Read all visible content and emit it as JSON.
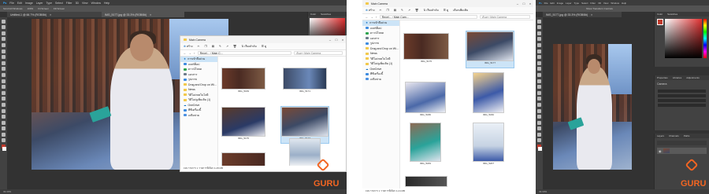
{
  "left_ps": {
    "menu": [
      "Ps",
      "File",
      "Edit",
      "Image",
      "Layer",
      "Type",
      "Select",
      "Filter",
      "3D",
      "View",
      "Window",
      "Help"
    ],
    "options": [
      "Scroll All Windows",
      "100%",
      "Fit Screen",
      "Fill Screen"
    ],
    "doc_tab": "Untitled-1 @ 66.7% (RGB/8#)",
    "doc_tab2": "IMG_5177.jpg @ 33.3% (RGB/8#)",
    "panel_tabs": [
      "Color",
      "Swatches"
    ],
    "status": "33.33%"
  },
  "left_explorer": {
    "title": "Main Camera",
    "new_label": "สร้าง",
    "sort_label": "เรียงลำดับ",
    "view_label": "ดู",
    "path": [
      "Recei...",
      "Main C..."
    ],
    "search_placeholder": "ค้นหา Main Camera",
    "nav": [
      "การเข้าถึงด่วน",
      "เดสก์ท็อป",
      "ดาวน์โหลด",
      "เอกสาร",
      "รูปภาพ",
      "Drag and Drop on Wi...",
      "News",
      "วิดีโอ/เทคโนโลยี",
      "วิดีโอ/ดูเพิ่มเติม (1)",
      "OneDrive",
      "พีซีเครื่องนี้",
      "เครือข่าย"
    ],
    "thumbs": [
      "IMG_5169",
      "IMG_5171",
      "IMG_5175",
      "IMG_5177",
      "",
      ""
    ],
    "status": "199 รายการ     1 รายการที่เลือก 4.28 MB"
  },
  "right_explorer": {
    "title": "Main Camera",
    "new_label": "สร้าง",
    "sort_label": "เรียงลำดับ",
    "view_label": "ดู",
    "more_label": "เลือกเพิ่มเติม",
    "path": [
      "Recei...",
      "Main Cam..."
    ],
    "search_placeholder": "ค้นหา Main Camera",
    "nav": [
      "การเข้าถึงด่วน",
      "เดสก์ท็อป",
      "ดาวน์โหลด",
      "เอกสาร",
      "รูปภาพ",
      "Drag and Drop on Wi...",
      "News",
      "วิดีโอ/เทคโนโลยี",
      "วิดีโอ/ดูเพิ่มเติม (1)",
      "OneDrive",
      "พีซีเครื่องนี้",
      "เครือข่าย"
    ],
    "thumbs": [
      "IMG_5175",
      "IMG_5177",
      "IMG_5180",
      "IMG_5182",
      "IMG_5184",
      "IMG_5207",
      ""
    ],
    "status": "199 รายการ     1 รายการที่เลือก 4.24 MB"
  },
  "right_ps": {
    "menu": [
      "Ps",
      "File",
      "Edit",
      "Image",
      "Layer",
      "Type",
      "Select",
      "Filter",
      "3D",
      "View",
      "Window",
      "Help"
    ],
    "options": [
      "Show Transform Controls"
    ],
    "doc_tab": "IMG_5177.jpg @ 33.3% (RGB/8#)",
    "panel_tabs": [
      "Color",
      "Swatches"
    ],
    "props_tabs": [
      "Properties",
      "Libraries",
      "Adjustments"
    ],
    "props_title": "Camera",
    "layers_tabs": [
      "Layers",
      "Channels",
      "Paths"
    ],
    "status": "33.33%"
  },
  "watermark": "GURU",
  "colors": {
    "ps_bg": "#323232",
    "accent": "#f26522",
    "selection": "#cce4f7"
  }
}
